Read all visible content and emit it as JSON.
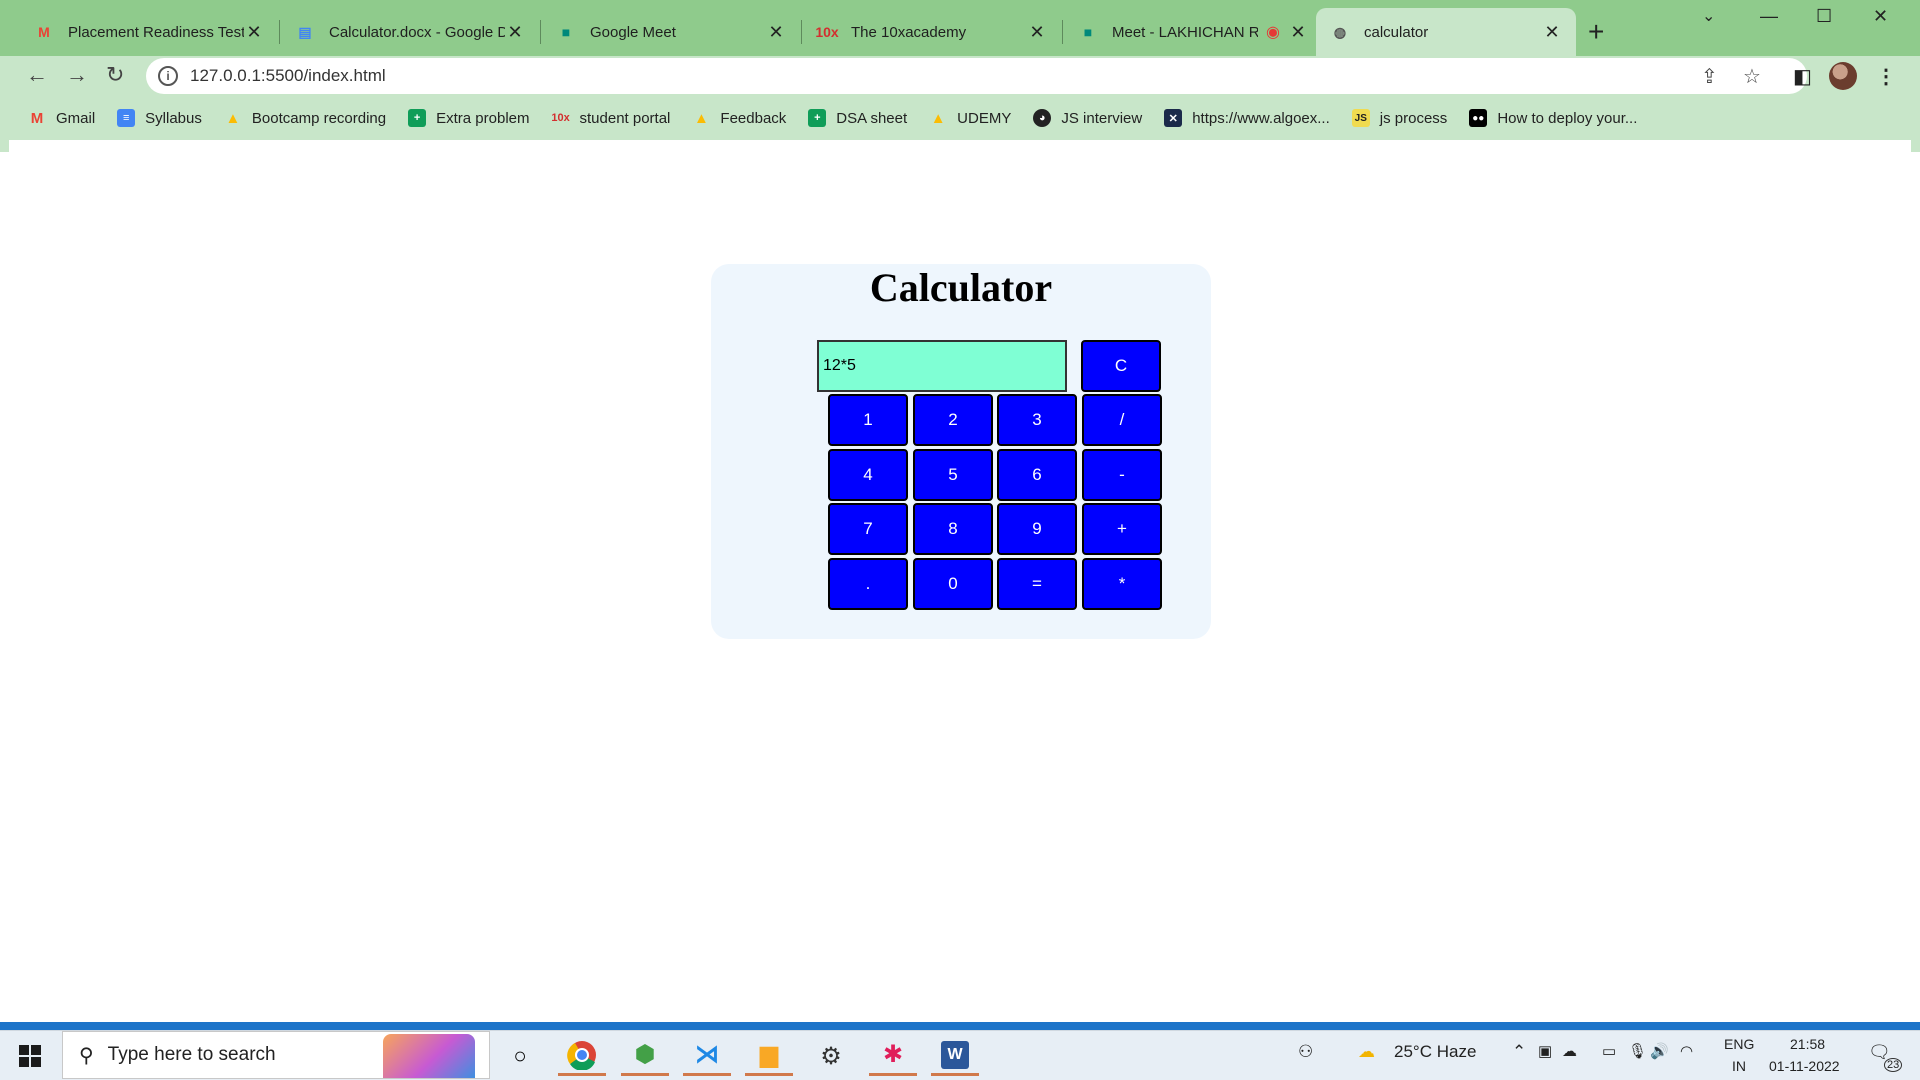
{
  "tabs": [
    {
      "title": "Placement Readiness Test (",
      "icon": "gmail-icon",
      "icon_color": "#ea4335"
    },
    {
      "title": "Calculator.docx - Google D",
      "icon": "google-docs-icon",
      "icon_color": "#4285f4"
    },
    {
      "title": "Google Meet",
      "icon": "google-meet-icon",
      "icon_color": "#00897b"
    },
    {
      "title": "The 10xacademy",
      "icon": "10x-icon",
      "icon_color": "#d32f2f"
    },
    {
      "title": "Meet - LAKHICHAN RO",
      "icon": "google-meet-icon",
      "icon_color": "#00897b"
    },
    {
      "title": "calculator",
      "icon": "globe-icon",
      "icon_color": "#555555"
    }
  ],
  "address_bar": {
    "url": "127.0.0.1:5500/index.html"
  },
  "bookmarks": [
    {
      "label": "Gmail",
      "icon": "gmail-icon",
      "color": "#ea4335"
    },
    {
      "label": "Syllabus",
      "icon": "google-docs-icon",
      "color": "#4285f4"
    },
    {
      "label": "Bootcamp recording",
      "icon": "google-drive-icon",
      "color": "#fbbc04"
    },
    {
      "label": "Extra problem",
      "icon": "google-sheets-icon",
      "color": "#0f9d58"
    },
    {
      "label": "student portal",
      "icon": "10x-icon",
      "color": "#d32f2f"
    },
    {
      "label": "Feedback",
      "icon": "google-drive-icon",
      "color": "#fbbc04"
    },
    {
      "label": "DSA sheet",
      "icon": "google-sheets-icon",
      "color": "#0f9d58"
    },
    {
      "label": "UDEMY",
      "icon": "google-drive-icon",
      "color": "#fbbc04"
    },
    {
      "label": "JS interview",
      "icon": "github-icon",
      "color": "#222222"
    },
    {
      "label": "https://www.algoex...",
      "icon": "algoexpert-icon",
      "color": "#1b2a4a"
    },
    {
      "label": "js process",
      "icon": "js-icon",
      "color": "#f0db4f"
    },
    {
      "label": "How to deploy your...",
      "icon": "medium-icon",
      "color": "#000000"
    }
  ],
  "calculator": {
    "title": "Calculator",
    "display_value": "12*5",
    "clear_label": "C",
    "keys": [
      "1",
      "2",
      "3",
      "/",
      "4",
      "5",
      "6",
      "-",
      "7",
      "8",
      "9",
      "+",
      ".",
      "0",
      "=",
      "*"
    ],
    "colors": {
      "button": "#0000ff",
      "display": "#7fffd4",
      "card": "#eef6fd"
    }
  },
  "taskbar": {
    "search_placeholder": "Type here to search",
    "weather": "25°C  Haze",
    "language": "ENG",
    "region": "IN",
    "time": "21:58",
    "date": "01-11-2022",
    "notifications": "23"
  }
}
